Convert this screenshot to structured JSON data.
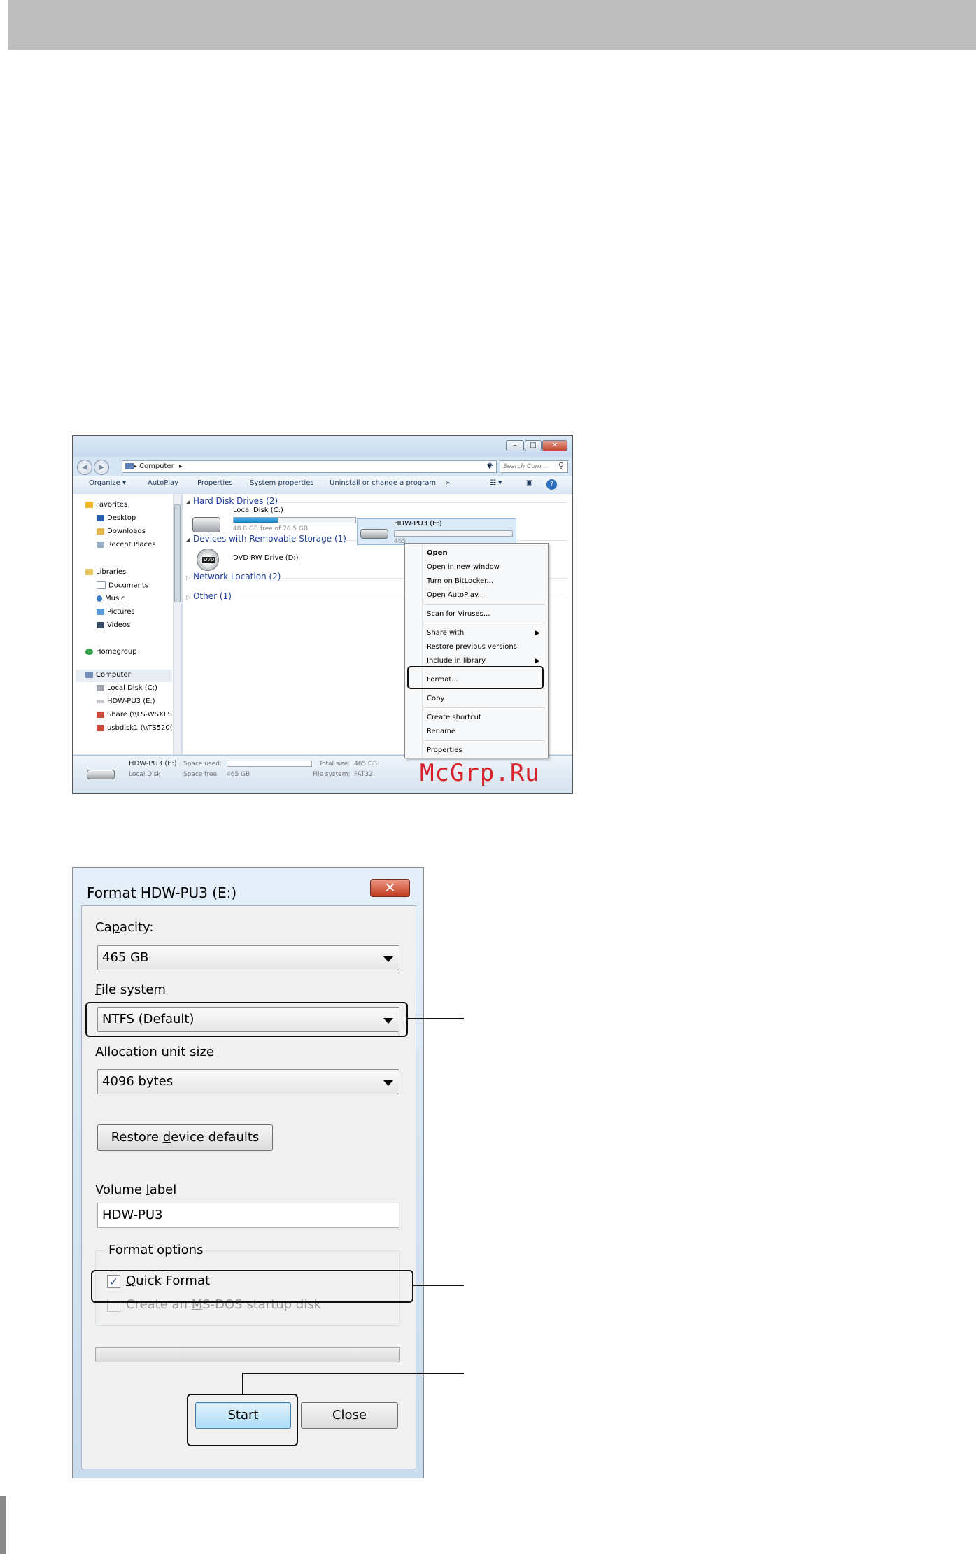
{
  "explorer": {
    "address": "Computer",
    "search_placeholder": "Search Com...",
    "toolbar": [
      "Organize ▾",
      "AutoPlay",
      "Properties",
      "System properties",
      "Uninstall or change a program",
      "»"
    ],
    "nav": {
      "favorites": "Favorites",
      "desktop": "Desktop",
      "downloads": "Downloads",
      "recent": "Recent Places",
      "libraries": "Libraries",
      "documents": "Documents",
      "music": "Music",
      "pictures": "Pictures",
      "videos": "Videos",
      "homegroup": "Homegroup",
      "computer": "Computer",
      "local_disk": "Local Disk (C:)",
      "hdw": "HDW-PU3 (E:)",
      "share": "Share (\\\\LS-WSXLS",
      "usbdisk": "usbdisk1 (\\\\TS520("
    },
    "groups": {
      "hdd": "Hard Disk Drives (2)",
      "removable": "Devices with Removable Storage (1)",
      "network": "Network Location (2)",
      "other": "Other (1)"
    },
    "drives": {
      "c_name": "Local Disk (C:)",
      "c_free": "48.8 GB free of 76.5 GB",
      "c_used_fraction": 0.36,
      "e_name": "HDW-PU3 (E:)",
      "e_free": "465",
      "e_used_fraction": 0.0,
      "dvd_name": "DVD RW Drive (D:)",
      "dvd_badge": "DVD"
    },
    "context_menu": {
      "open": "Open",
      "open_new": "Open in new window",
      "bitlocker": "Turn on BitLocker...",
      "autoplay": "Open AutoPlay...",
      "scan": "Scan for Viruses...",
      "share_with": "Share with",
      "restore": "Restore previous versions",
      "include": "Include in library",
      "format": "Format...",
      "copy": "Copy",
      "shortcut": "Create shortcut",
      "rename": "Rename",
      "properties": "Properties"
    },
    "status": {
      "name": "HDW-PU3 (E:)",
      "type": "Local Disk",
      "space_used_label": "Space used:",
      "space_free_label": "Space free:",
      "space_free": "465 GB",
      "total_size_label": "Total size:",
      "total_size": "465 GB",
      "fs_label": "File system:",
      "fs": "FAT32"
    }
  },
  "watermark": "McGrp.Ru",
  "dialog": {
    "title": "Format HDW-PU3 (E:)",
    "close_glyph": "✕",
    "capacity_label_pre": "Ca",
    "capacity_label_key": "p",
    "capacity_label_post": "acity:",
    "capacity_value": "465 GB",
    "fs_label_key": "F",
    "fs_label_post": "ile system",
    "fs_value": "NTFS (Default)",
    "alloc_label_key": "A",
    "alloc_label_post": "llocation unit size",
    "alloc_value": "4096 bytes",
    "restore_pre": "Restore ",
    "restore_key": "d",
    "restore_post": "evice defaults",
    "volume_label_pre": "Volume ",
    "volume_label_key": "l",
    "volume_label_post": "abel",
    "volume_value": "HDW-PU3",
    "options_pre": "Format ",
    "options_key": "o",
    "options_post": "ptions",
    "quick_key": "Q",
    "quick_post": "uick Format",
    "quick_checked": true,
    "msdos_pre": "Create an ",
    "msdos_key": "M",
    "msdos_post": "S-DOS startup disk",
    "msdos_checked": false,
    "start": "Start",
    "close_pre": "",
    "close_key": "C",
    "close_post": "lose"
  },
  "colors": {
    "header_band": "#bdbdbd",
    "watermark": "#d8232a",
    "link_blue": "#1e3e9c"
  }
}
